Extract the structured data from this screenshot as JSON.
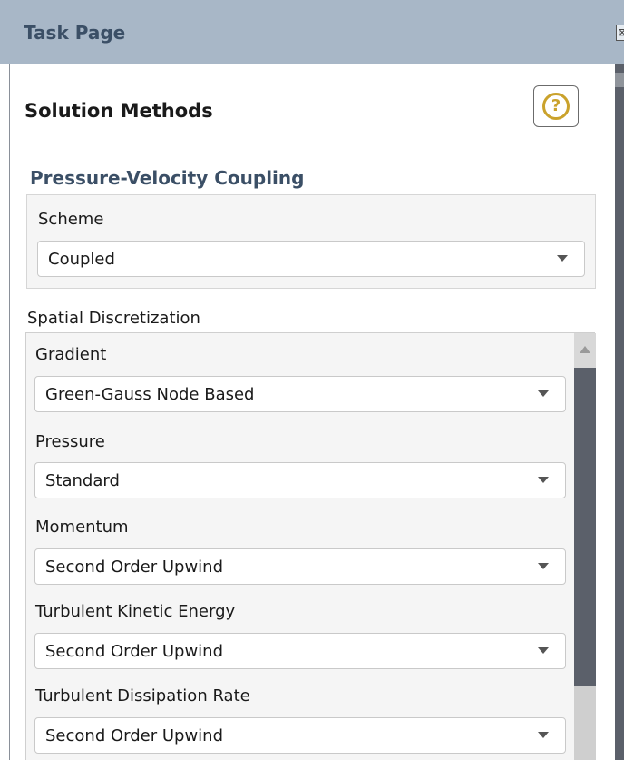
{
  "header": {
    "title": "Task Page",
    "close_glyph": "⊠"
  },
  "panel": {
    "title": "Solution Methods",
    "help_icon": "help-icon",
    "help_glyph": "?"
  },
  "pressure_velocity": {
    "title": "Pressure-Velocity Coupling",
    "scheme_label": "Scheme",
    "scheme_value": "Coupled"
  },
  "spatial": {
    "title": "Spatial Discretization",
    "fields": [
      {
        "label": "Gradient",
        "value": "Green-Gauss Node Based"
      },
      {
        "label": "Pressure",
        "value": "Standard"
      },
      {
        "label": "Momentum",
        "value": "Second Order Upwind"
      },
      {
        "label": "Turbulent Kinetic Energy",
        "value": "Second Order Upwind"
      },
      {
        "label": "Turbulent Dissipation Rate",
        "value": "Second Order Upwind"
      }
    ]
  }
}
